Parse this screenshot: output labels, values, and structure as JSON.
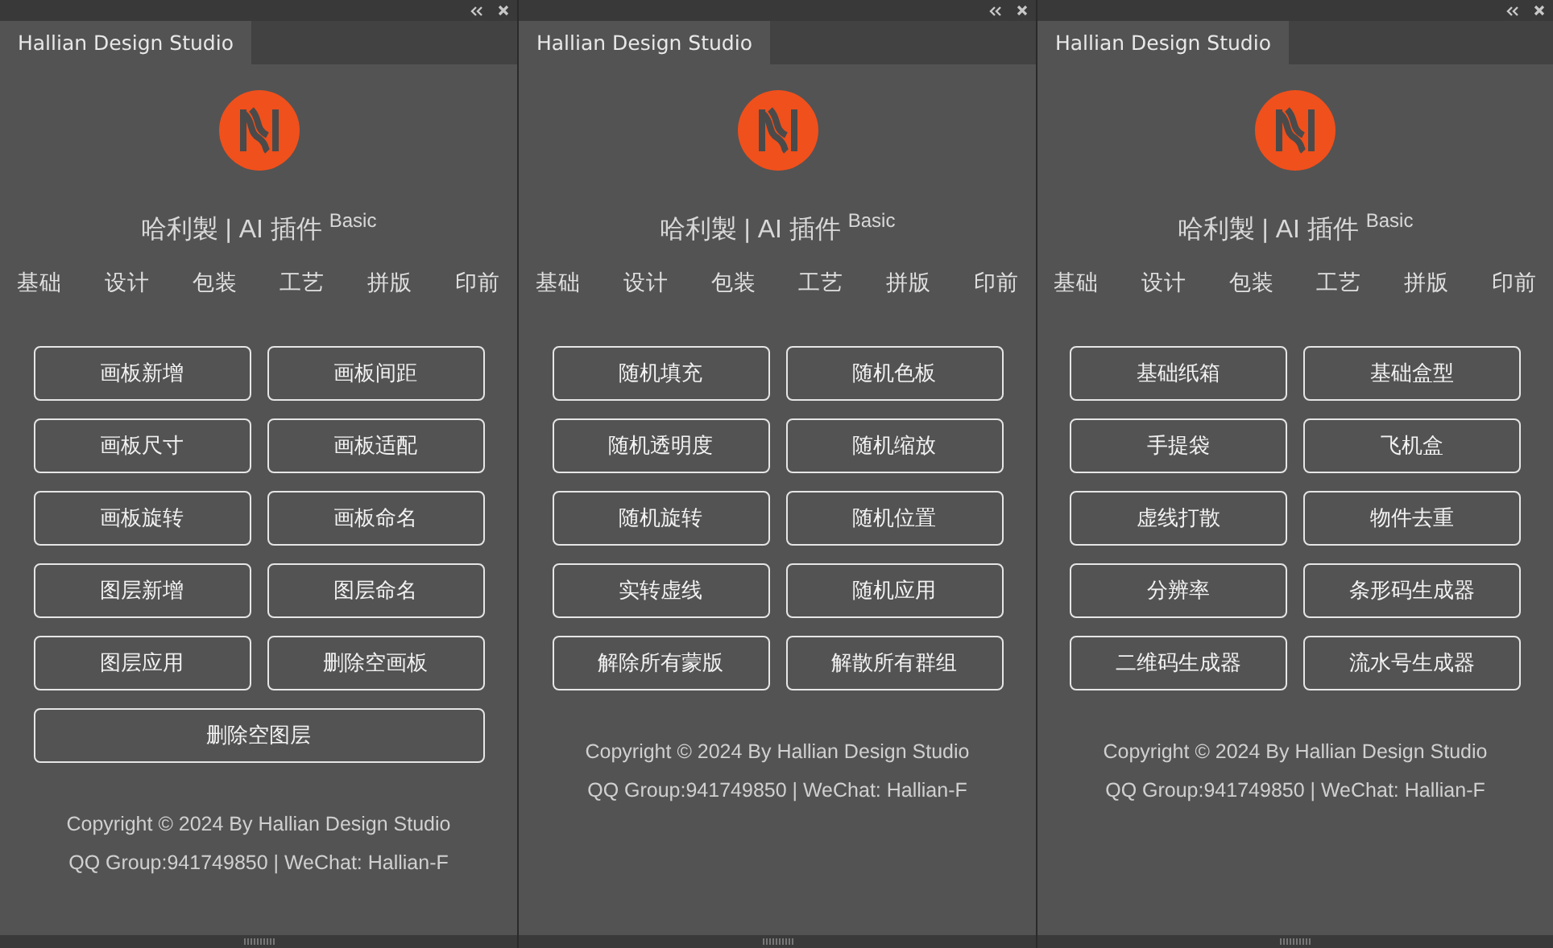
{
  "panels": [
    {
      "tab": {
        "label": "Hallian Design Studio",
        "selected": true
      },
      "title": "哈利製 | AI 插件 $^{Basic}$",
      "nav": [
        "基础",
        "设计",
        "包装",
        "工艺",
        "拼版",
        "印前"
      ],
      "buttons": [
        {
          "label": "画板新增",
          "kind": "half"
        },
        {
          "label": "画板间距",
          "kind": "half"
        },
        {
          "label": "画板尺寸",
          "kind": "half"
        },
        {
          "label": "画板适配",
          "kind": "half"
        },
        {
          "label": "画板旋转",
          "kind": "half"
        },
        {
          "label": "画板命名",
          "kind": "half"
        },
        {
          "label": "图层新增",
          "kind": "half"
        },
        {
          "label": "图层命名",
          "kind": "half"
        },
        {
          "label": "图层应用",
          "kind": "half"
        },
        {
          "label": "删除空画板",
          "kind": "half"
        },
        {
          "label": "删除空图层",
          "kind": "full"
        }
      ],
      "footer": [
        "Copyright © 2024 By Hallian Design Studio",
        "QQ Group:941749850 | WeChat: Hallian-F"
      ]
    },
    {
      "tab": {
        "label": "Hallian Design Studio",
        "selected": true
      },
      "title": "哈利製 | AI 插件 $^{Basic}$",
      "nav": [
        "基础",
        "设计",
        "包装",
        "工艺",
        "拼版",
        "印前"
      ],
      "buttons": [
        {
          "label": "随机填充",
          "kind": "half"
        },
        {
          "label": "随机色板",
          "kind": "half"
        },
        {
          "label": "随机透明度",
          "kind": "half"
        },
        {
          "label": "随机缩放",
          "kind": "half"
        },
        {
          "label": "随机旋转",
          "kind": "half"
        },
        {
          "label": "随机位置",
          "kind": "half"
        },
        {
          "label": "实转虚线",
          "kind": "half"
        },
        {
          "label": "随机应用",
          "kind": "half"
        },
        {
          "label": "解除所有蒙版",
          "kind": "half"
        },
        {
          "label": "解散所有群组",
          "kind": "half"
        }
      ],
      "footer": [
        "Copyright © 2024 By Hallian Design Studio",
        "QQ Group:941749850 | WeChat: Hallian-F"
      ]
    },
    {
      "tab": {
        "label": "Hallian Design Studio",
        "selected": true
      },
      "title": "哈利製 | AI 插件 $^{Basic}$",
      "nav": [
        "基础",
        "设计",
        "包装",
        "工艺",
        "拼版",
        "印前"
      ],
      "buttons": [
        {
          "label": "基础纸箱",
          "kind": "half"
        },
        {
          "label": "基础盒型",
          "kind": "half"
        },
        {
          "label": "手提袋",
          "kind": "half"
        },
        {
          "label": "飞机盒",
          "kind": "half"
        },
        {
          "label": "虚线打散",
          "kind": "half"
        },
        {
          "label": "物件去重",
          "kind": "half"
        },
        {
          "label": "分辨率",
          "kind": "half"
        },
        {
          "label": "条形码生成器",
          "kind": "half"
        },
        {
          "label": "二维码生成器",
          "kind": "half"
        },
        {
          "label": "流水号生成器",
          "kind": "half"
        }
      ],
      "footer": [
        "Copyright © 2024 By Hallian Design Studio",
        "QQ Group:941749850 | WeChat: Hallian-F"
      ]
    }
  ]
}
